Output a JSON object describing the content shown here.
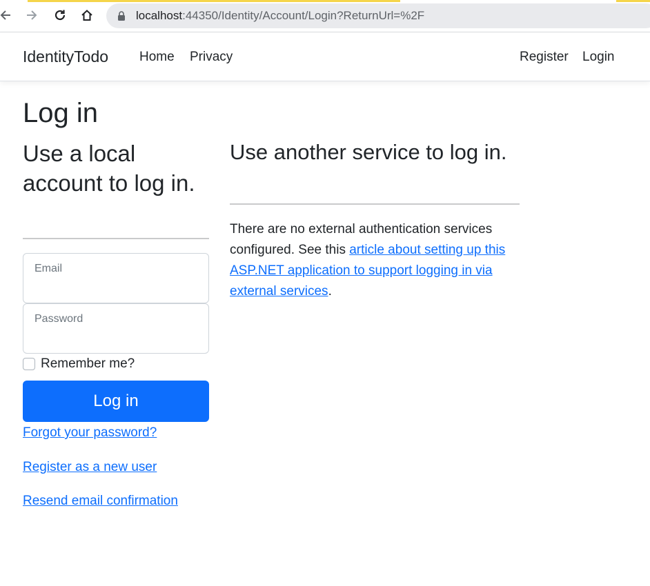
{
  "browser": {
    "url_host": "localhost",
    "url_path": ":44350/Identity/Account/Login?ReturnUrl=%2F",
    "accent_loadbar": "#f5d54a"
  },
  "navbar": {
    "brand": "IdentityTodo",
    "links": [
      {
        "label": "Home"
      },
      {
        "label": "Privacy"
      }
    ],
    "right_links": [
      {
        "label": "Register"
      },
      {
        "label": "Login"
      }
    ]
  },
  "page": {
    "title": "Log in",
    "local_section": {
      "heading": "Use a local account to log in.",
      "email_label": "Email",
      "email_value": "",
      "password_label": "Password",
      "password_value": "",
      "remember_label": "Remember me?",
      "remember_checked": false,
      "submit_label": "Log in",
      "forgot_link": "Forgot your password?",
      "register_link": "Register as a new user",
      "resend_link": "Resend email confirmation"
    },
    "external_section": {
      "heading": "Use another service to log in.",
      "text_before": "There are no external authentication services configured. See this ",
      "link_text": "article about setting up this ASP.NET application to support logging in via external services",
      "text_after": "."
    }
  },
  "colors": {
    "primary": "#0d6efd",
    "text": "#212529",
    "muted": "#6c757d"
  }
}
